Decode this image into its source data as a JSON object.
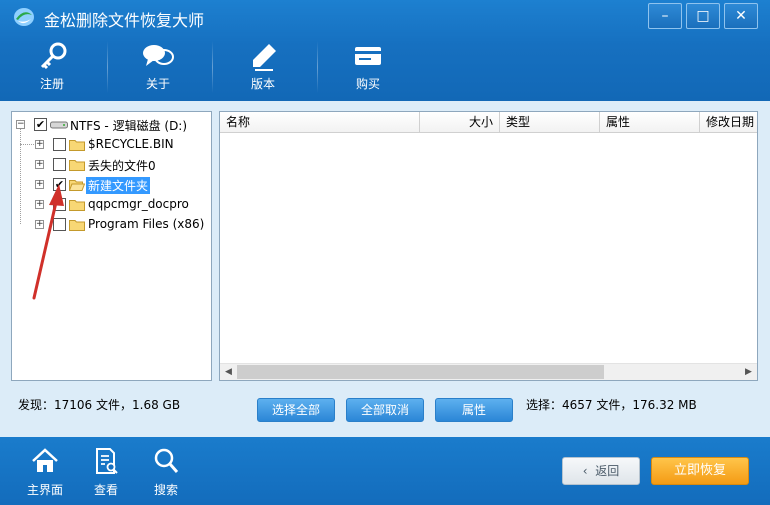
{
  "app": {
    "title": "金松删除文件恢复大师"
  },
  "window_controls": {
    "minimize": "–",
    "maximize": "□",
    "close": "✕"
  },
  "toolbar": [
    {
      "label": "注册",
      "icon": "key-icon"
    },
    {
      "label": "关于",
      "icon": "chat-bubbles-icon"
    },
    {
      "label": "版本",
      "icon": "pen-icon"
    },
    {
      "label": "购买",
      "icon": "card-icon"
    }
  ],
  "tree": {
    "root": {
      "label": "NTFS - 逻辑磁盘 (D:)",
      "checked": true
    },
    "items": [
      {
        "label": "$RECYCLE.BIN",
        "checked": false,
        "selected": false
      },
      {
        "label": "丢失的文件0",
        "checked": false,
        "selected": false
      },
      {
        "label": "新建文件夹",
        "checked": true,
        "selected": true
      },
      {
        "label": "qqpcmgr_docpro",
        "checked": false,
        "selected": false
      },
      {
        "label": "Program Files (x86)",
        "checked": false,
        "selected": false
      }
    ]
  },
  "list": {
    "columns": [
      "名称",
      "大小",
      "类型",
      "属性",
      "修改日期"
    ],
    "rows": []
  },
  "status": {
    "found": "发现：17106 文件，1.68 GB",
    "selected": "选择：4657 文件，176.32 MB"
  },
  "actions": {
    "select_all": "选择全部",
    "deselect_all": "全部取消",
    "properties": "属性"
  },
  "bottom_nav": [
    {
      "label": "主界面",
      "icon": "home-icon"
    },
    {
      "label": "查看",
      "icon": "document-view-icon"
    },
    {
      "label": "搜索",
      "icon": "search-icon"
    }
  ],
  "buttons": {
    "back": "返回",
    "recover": "立即恢复"
  },
  "colors": {
    "brand_blue": "#1670c0",
    "selection": "#3399ff",
    "recover_orange": "#f49b15",
    "annotation": "#d0302a"
  }
}
